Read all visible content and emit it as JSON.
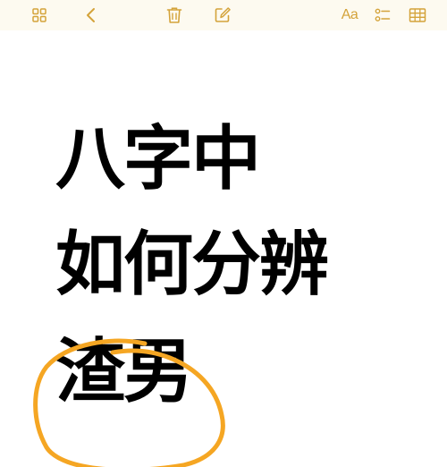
{
  "toolbar": {
    "accent": "#d4a33a",
    "buttons": [
      {
        "name": "gallery-view-icon"
      },
      {
        "name": "back-chevron-icon"
      },
      {
        "name": "trash-icon"
      },
      {
        "name": "compose-icon"
      },
      {
        "name": "text-format-button",
        "label": "Aa"
      },
      {
        "name": "checklist-icon"
      },
      {
        "name": "table-icon"
      }
    ]
  },
  "note": {
    "lines": [
      "八字中",
      "如何分辨",
      "渣男"
    ],
    "text_color": "#000000",
    "highlight_color": "#f5a623"
  }
}
